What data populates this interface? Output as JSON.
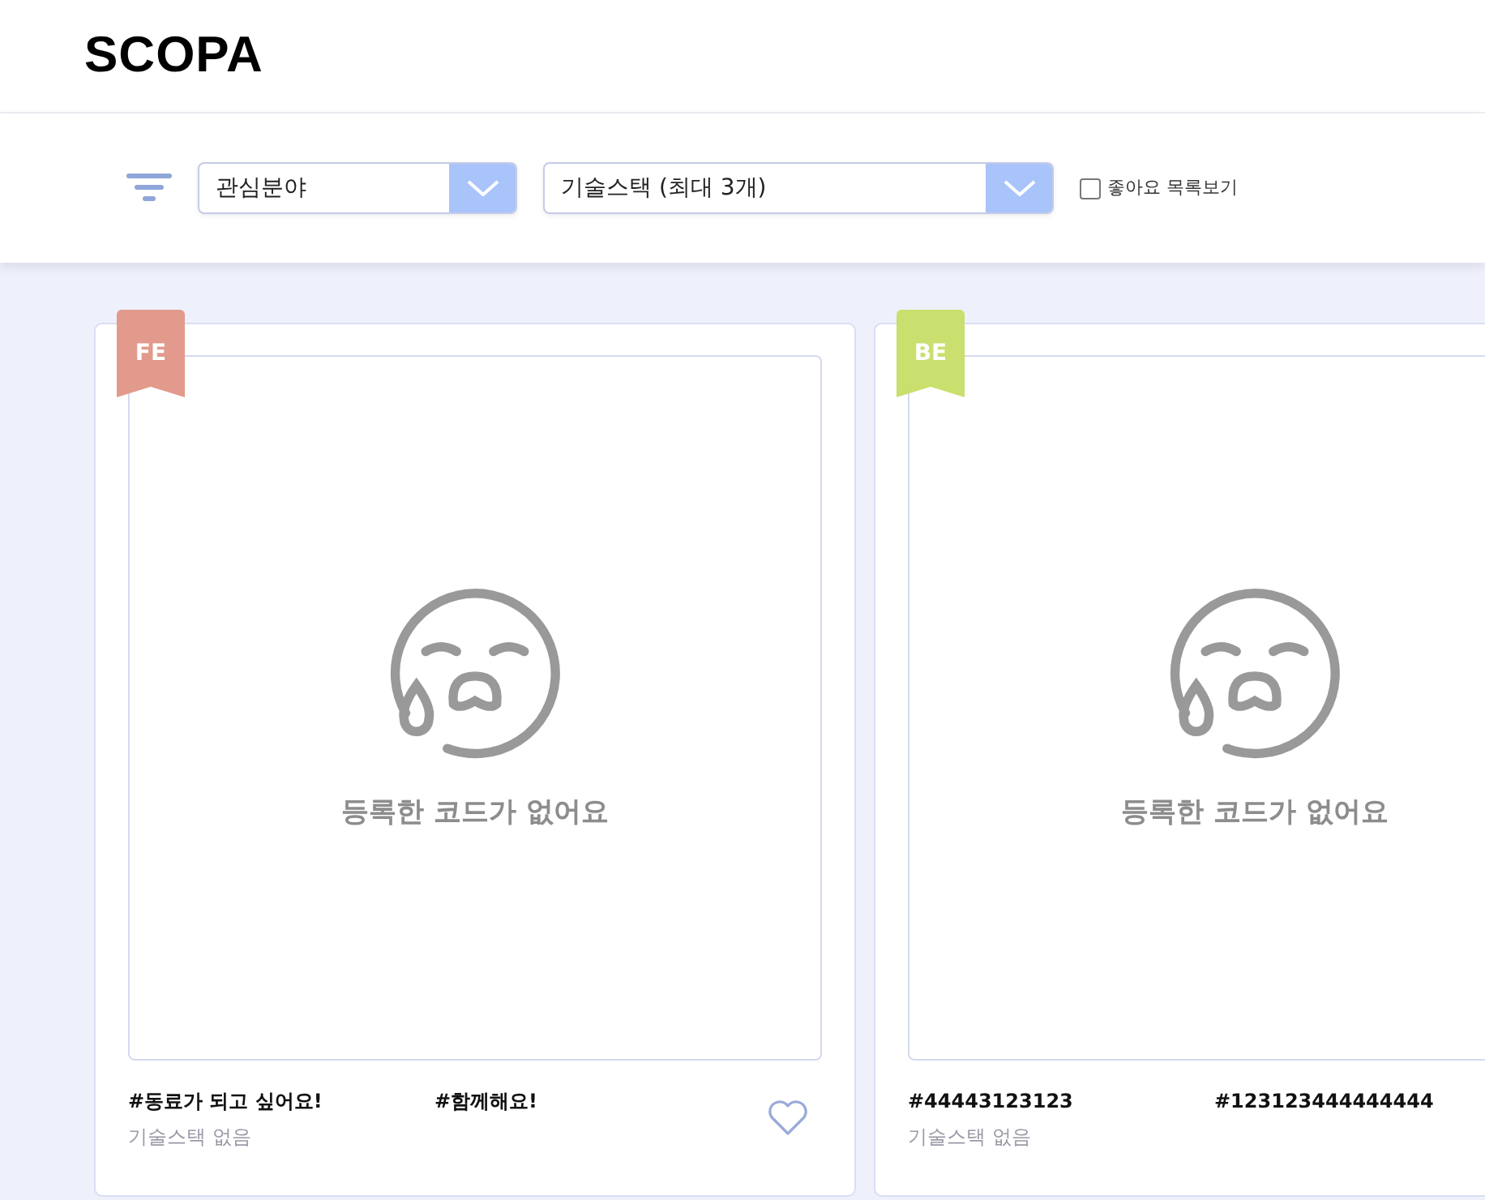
{
  "logo": "SCOPA",
  "filters": {
    "interest": {
      "value": "관심분야"
    },
    "stack": {
      "value": "기술스택 (최대 3개)"
    },
    "liked_only": {
      "label": "좋아요 목록보기",
      "checked": false
    }
  },
  "cards": [
    {
      "ribbon": "FE",
      "color": "#e29a8c",
      "empty_text": "등록한 코드가 없어요",
      "tags": [
        "#동료가 되고 싶어요!",
        "#함께해요!"
      ],
      "stack_text": "기술스택 없음",
      "liked": false
    },
    {
      "ribbon": "BE",
      "color": "#c9df6e",
      "empty_text": "등록한 코드가 없어요",
      "tags": [
        "#44443123123",
        "#123123444444444"
      ],
      "stack_text": "기술스택 없음"
    }
  ]
}
